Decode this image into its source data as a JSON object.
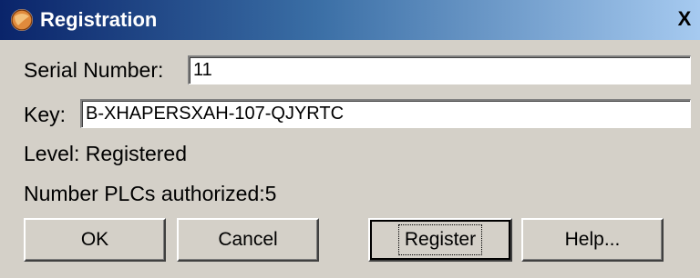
{
  "window": {
    "title": "Registration",
    "close_glyph": "X",
    "icon": "app-globe-icon"
  },
  "form": {
    "serial_label": "Serial Number:",
    "serial_value": "11",
    "key_label": "Key:",
    "key_value": "B-XHAPERSXAH-107-QJYRTC",
    "level_text": "Level: Registered",
    "plcs_text": "Number PLCs authorized:5"
  },
  "buttons": {
    "ok": "OK",
    "cancel": "Cancel",
    "register": "Register",
    "help": "Help..."
  },
  "colors": {
    "title_gradient_start": "#0a246a",
    "title_gradient_end": "#a6caf0",
    "dialog_bg": "#d4d0c8"
  }
}
